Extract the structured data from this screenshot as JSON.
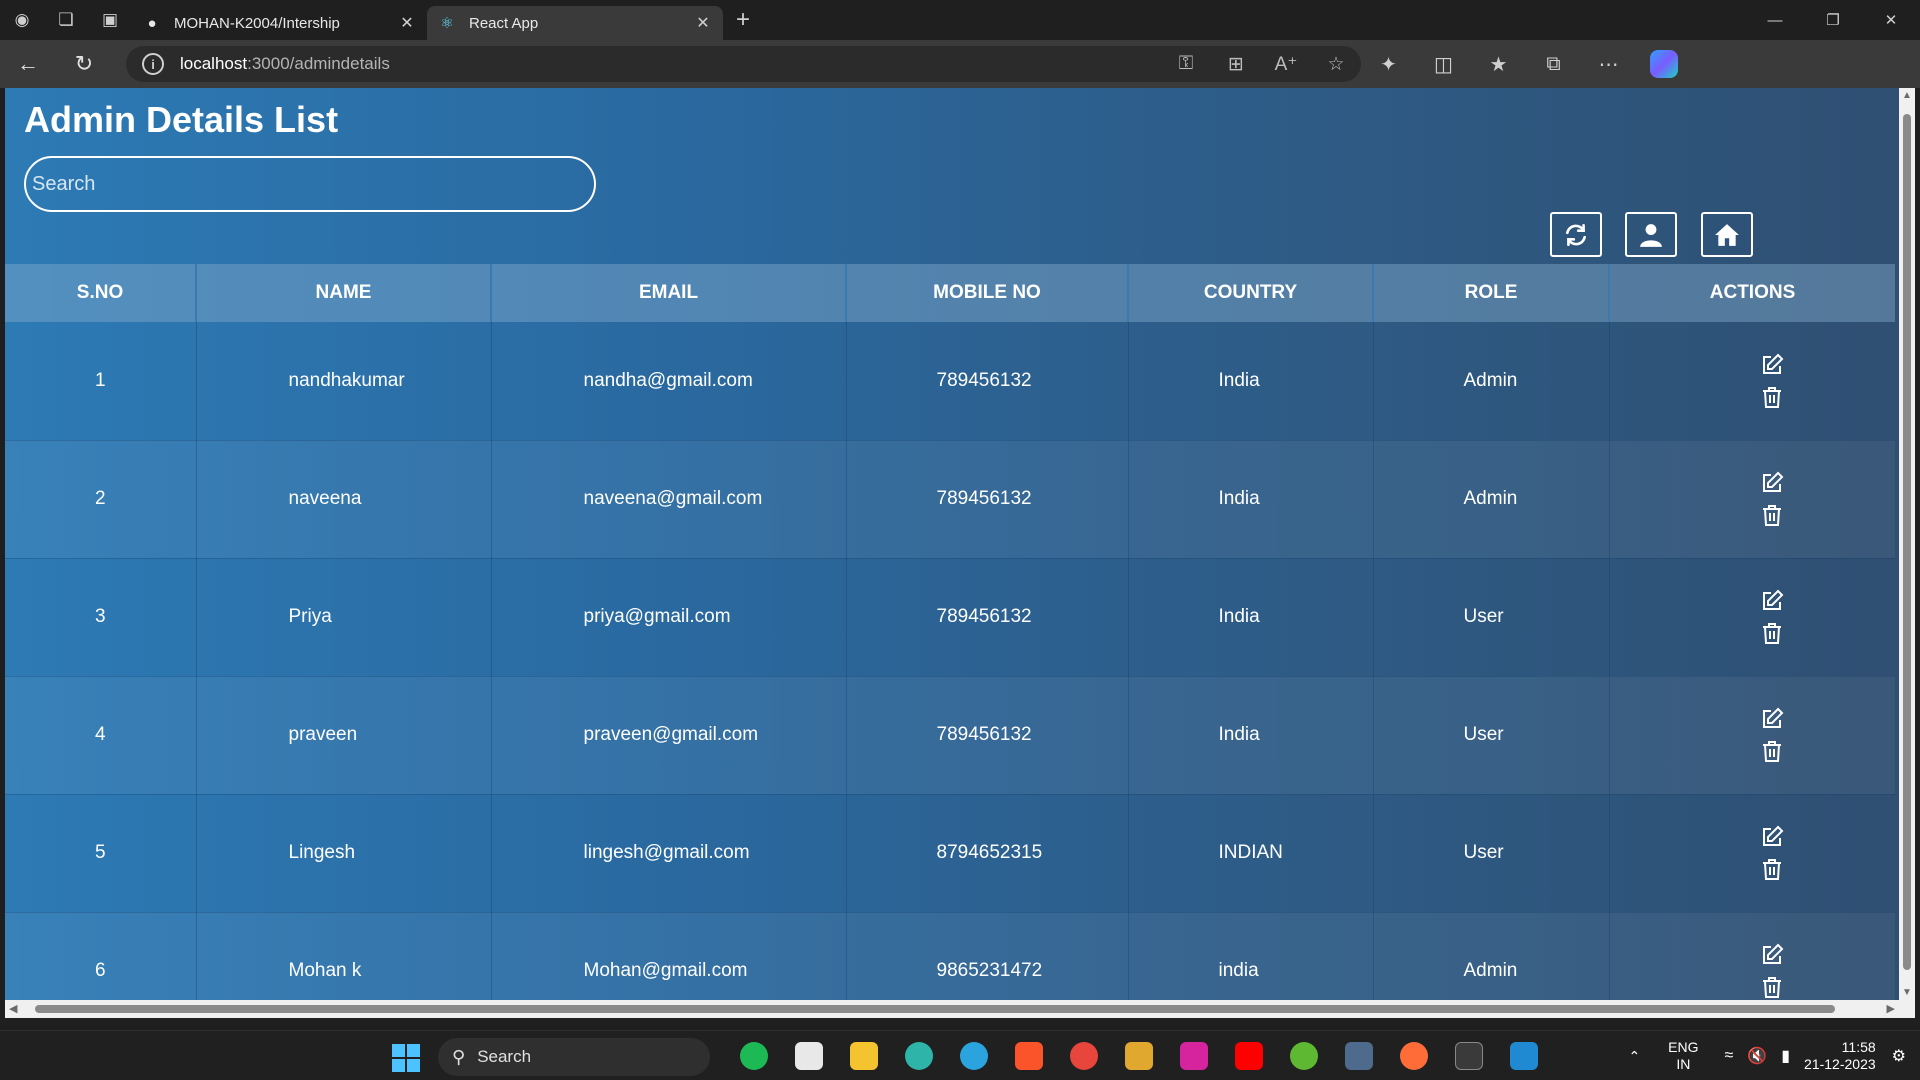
{
  "browser": {
    "tabs": [
      {
        "title": "MOHAN-K2004/Intership",
        "icon": "github-icon"
      },
      {
        "title": "React App",
        "icon": "react-icon"
      }
    ],
    "url_host": "localhost",
    "url_path": ":3000/admindetails"
  },
  "page": {
    "title": "Admin Details List",
    "search_placeholder": "Search"
  },
  "table": {
    "columns": [
      "S.NO",
      "NAME",
      "EMAIL",
      "MOBILE NO",
      "COUNTRY",
      "ROLE",
      "ACTIONS"
    ],
    "rows": [
      {
        "sno": "1",
        "name": "nandhakumar",
        "email": "nandha@gmail.com",
        "mobile": "789456132",
        "country": "India",
        "role": "Admin"
      },
      {
        "sno": "2",
        "name": "naveena",
        "email": "naveena@gmail.com",
        "mobile": "789456132",
        "country": "India",
        "role": "Admin"
      },
      {
        "sno": "3",
        "name": "Priya",
        "email": "priya@gmail.com",
        "mobile": "789456132",
        "country": "India",
        "role": "User"
      },
      {
        "sno": "4",
        "name": "praveen",
        "email": "praveen@gmail.com",
        "mobile": "789456132",
        "country": "India",
        "role": "User"
      },
      {
        "sno": "5",
        "name": "Lingesh",
        "email": "lingesh@gmail.com",
        "mobile": "8794652315",
        "country": "INDIAN",
        "role": "User"
      },
      {
        "sno": "6",
        "name": "Mohan k",
        "email": "Mohan@gmail.com",
        "mobile": "9865231472",
        "country": "india",
        "role": "Admin"
      }
    ]
  },
  "taskbar": {
    "search_label": "Search",
    "lang_line1": "ENG",
    "lang_line2": "IN",
    "time": "11:58",
    "date": "21-12-2023"
  },
  "colors": {
    "page_gradient_left": "#2d7ab5",
    "page_gradient_right": "#2f4f71",
    "header_accent": "#82aacd"
  }
}
